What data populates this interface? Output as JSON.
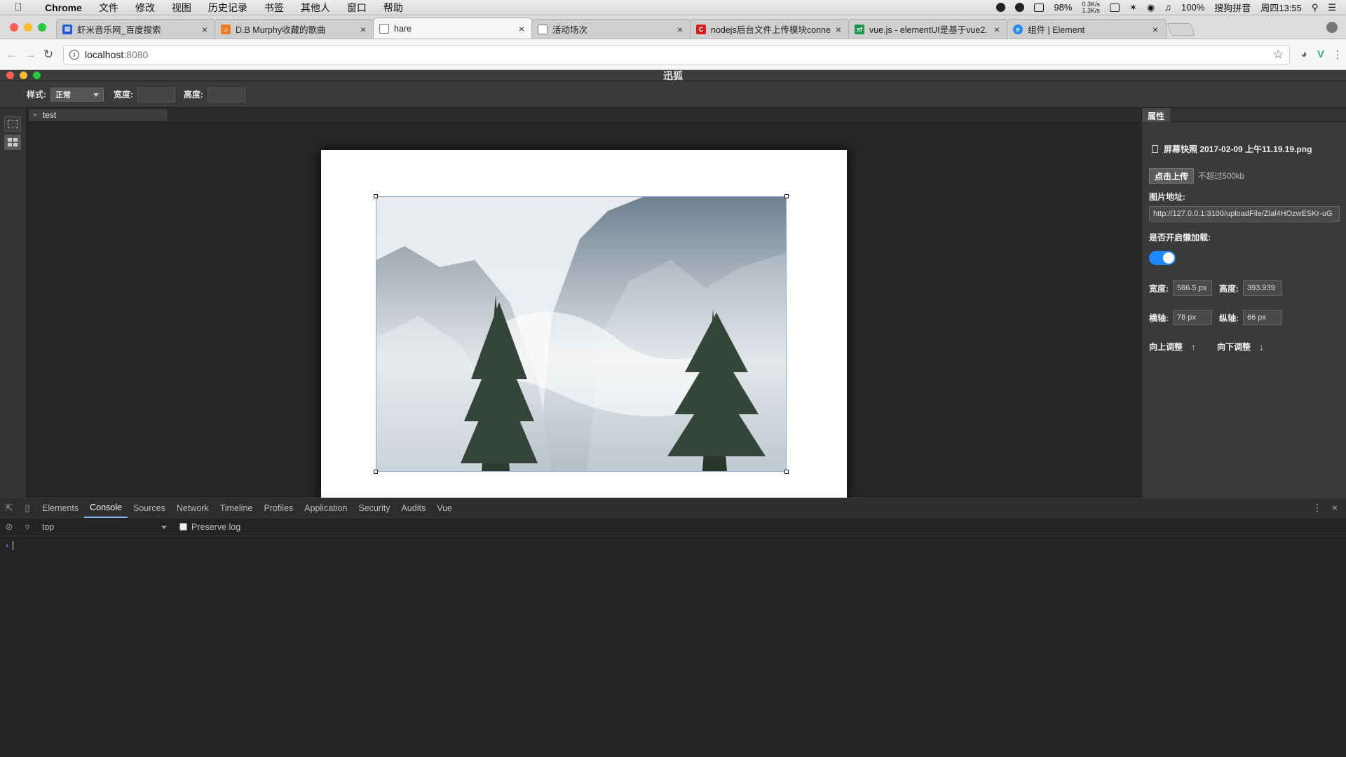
{
  "menubar": {
    "app": "Chrome",
    "items": [
      "文件",
      "修改",
      "视图",
      "历史记录",
      "书签",
      "其他人",
      "窗口",
      "帮助"
    ],
    "status": {
      "battery_small": "98%",
      "net_up": "0.3K/s",
      "net_down": "1.3K/s",
      "battery": "100%",
      "ime": "搜狗拼音",
      "clock": "周四13:55"
    }
  },
  "tabs": [
    {
      "title": "虾米音乐网_百度搜索",
      "color": "#2a5bd7"
    },
    {
      "title": "D.B Murphy收藏的歌曲",
      "color": "#f07a22"
    },
    {
      "title": "hare",
      "color": "#888888"
    },
    {
      "title": "活动场次",
      "color": "#888888"
    },
    {
      "title": "nodejs后台文件上传模块conne",
      "color": "#d81e1e"
    },
    {
      "title": "vue.js - elementUI是基于vue2.",
      "color": "#1a9a4a"
    },
    {
      "title": "组件 | Element",
      "color": "#2d8cf0"
    }
  ],
  "address": {
    "host": "localhost",
    "port": ":8080"
  },
  "app": {
    "title": "迅狐",
    "toolbar": {
      "style_label": "样式:",
      "style_value": "正常",
      "width_label": "宽度:",
      "height_label": "高度:"
    },
    "doc_tab": "test"
  },
  "props": {
    "tab": "属性",
    "file_name": "屏幕快照 2017-02-09 上午11.19.19.png",
    "upload_button": "点击上传",
    "upload_hint": "不超过500kb",
    "url_label": "图片地址:",
    "url_value": "http://127.0.0.1:3100/uploadFile/Zlal4HOzwESKr-uG",
    "lazy_label": "是否开启懒加载:",
    "lazy_on": true,
    "width_label": "宽度:",
    "width_value": "586.5 px",
    "height_label": "高度:",
    "height_value": "393.939",
    "x_label": "横轴:",
    "x_value": "78 px",
    "y_label": "纵轴:",
    "y_value": "66 px",
    "up_label": "向上调整",
    "down_label": "向下调整"
  },
  "devtools": {
    "tabs": [
      "Elements",
      "Console",
      "Sources",
      "Network",
      "Timeline",
      "Profiles",
      "Application",
      "Security",
      "Audits",
      "Vue"
    ],
    "active": "Console",
    "context": "top",
    "preserve_log": "Preserve log"
  }
}
